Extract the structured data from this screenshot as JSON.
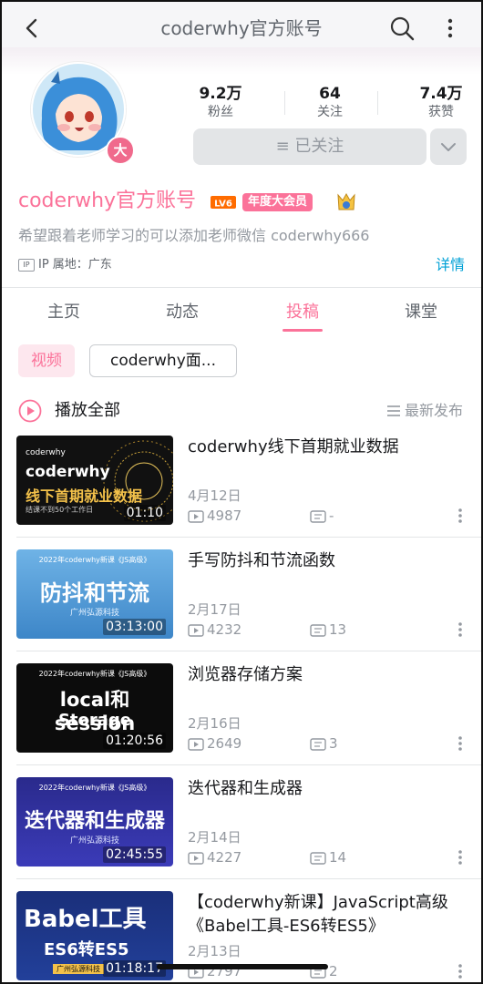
{
  "nav": {
    "title": "coderwhy官方账号"
  },
  "profile": {
    "badge": "大",
    "stats": [
      {
        "value": "9.2万",
        "label": "粉丝"
      },
      {
        "value": "64",
        "label": "关注"
      },
      {
        "value": "7.4万",
        "label": "获赞"
      }
    ],
    "follow_label": "≡ 已关注",
    "name": "coderwhy官方账号",
    "level": "LV6",
    "vip_label": "年度大会员",
    "bio": "希望跟着老师学习的可以添加老师微信 coderwhy666",
    "ip_badge": "IP",
    "ip_location": "IP 属地：广东",
    "detail_label": "详情"
  },
  "tabs": [
    {
      "label": "主页",
      "active": false
    },
    {
      "label": "动态",
      "active": false
    },
    {
      "label": "投稿",
      "active": true
    },
    {
      "label": "课堂",
      "active": false
    }
  ],
  "filters": {
    "video_chip": "视频",
    "search_chip": "coderwhy面..."
  },
  "list_header": {
    "play_all": "播放全部",
    "sort_label": "最新发布"
  },
  "videos": [
    {
      "title": "coderwhy线下首期就业数据",
      "date": "4月12日",
      "plays": "4987",
      "danmu": "-",
      "duration": "01:10",
      "thumb": {
        "line1": "coderwhy",
        "line2": "coderwhy",
        "line3": "线下首期就业数据",
        "line4": "结课不到50个工作日"
      }
    },
    {
      "title": "手写防抖和节流函数",
      "date": "2月17日",
      "plays": "4232",
      "danmu": "13",
      "duration": "03:13:00",
      "thumb": {
        "line1": "2022年coderwhy新课《JS高级》",
        "line2": "防抖和节流",
        "line3": "广州弘源科技"
      }
    },
    {
      "title": "浏览器存储方案",
      "date": "2月16日",
      "plays": "2649",
      "danmu": "3",
      "duration": "01:20:56",
      "thumb": {
        "line1": "2022年coderwhy新课《JS高级》",
        "line2": "local和 session",
        "line3": "Storage"
      }
    },
    {
      "title": "迭代器和生成器",
      "date": "2月14日",
      "plays": "4227",
      "danmu": "14",
      "duration": "02:45:55",
      "thumb": {
        "line1": "2022年coderwhy新课《JS高级》",
        "line2": "迭代器和生成器",
        "line3": "广州弘源科技"
      }
    },
    {
      "title": "【coderwhy新课】JavaScript高级《Babel工具-ES6转ES5》",
      "date": "2月13日",
      "plays": "2797",
      "danmu": "2",
      "duration": "01:18:17",
      "thumb": {
        "line1": "Babel工具",
        "line2": "ES6转ES5",
        "line3": "广州弘源科技"
      }
    }
  ],
  "colors": {
    "accent": "#fb7299",
    "link": "#00a1d6",
    "muted": "#9499a0"
  }
}
